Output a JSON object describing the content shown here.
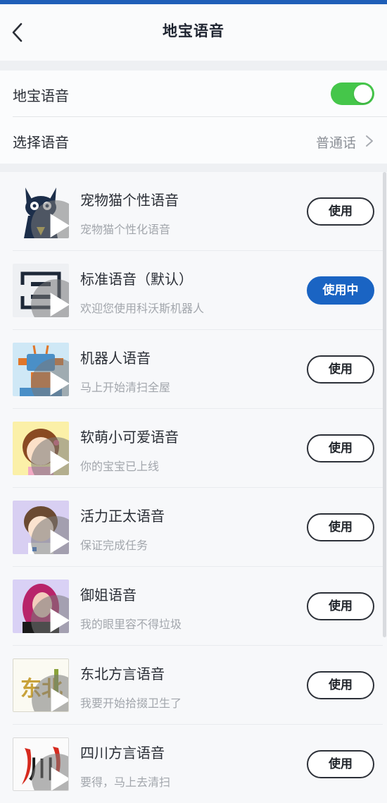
{
  "header": {
    "title": "地宝语音"
  },
  "settings": {
    "voice_label": "地宝语音",
    "voice_enabled": true,
    "select_label": "选择语音",
    "select_value": "普通话"
  },
  "voices": [
    {
      "title": "宠物猫个性语音",
      "subtitle": "宠物猫个性化语音",
      "button": "使用",
      "active": false
    },
    {
      "title": "标准语音（默认）",
      "subtitle": "欢迎您使用科沃斯机器人",
      "button": "使用中",
      "active": true
    },
    {
      "title": "机器人语音",
      "subtitle": "马上开始清扫全屋",
      "button": "使用",
      "active": false
    },
    {
      "title": "软萌小可爱语音",
      "subtitle": "你的宝宝已上线",
      "button": "使用",
      "active": false
    },
    {
      "title": "活力正太语音",
      "subtitle": "保证完成任务",
      "button": "使用",
      "active": false
    },
    {
      "title": "御姐语音",
      "subtitle": "我的眼里容不得垃圾",
      "button": "使用",
      "active": false
    },
    {
      "title": "东北方言语音",
      "subtitle": "我要开始拾掇卫生了",
      "button": "使用",
      "active": false,
      "thumb_text": "东北"
    },
    {
      "title": "四川方言语音",
      "subtitle": "要得，马上去清扫",
      "button": "使用",
      "active": false,
      "thumb_text": "川"
    }
  ],
  "colors": {
    "accent": "#1a64c3",
    "toggle_on": "#45c64a",
    "status_bar": "#1f5fb8"
  }
}
